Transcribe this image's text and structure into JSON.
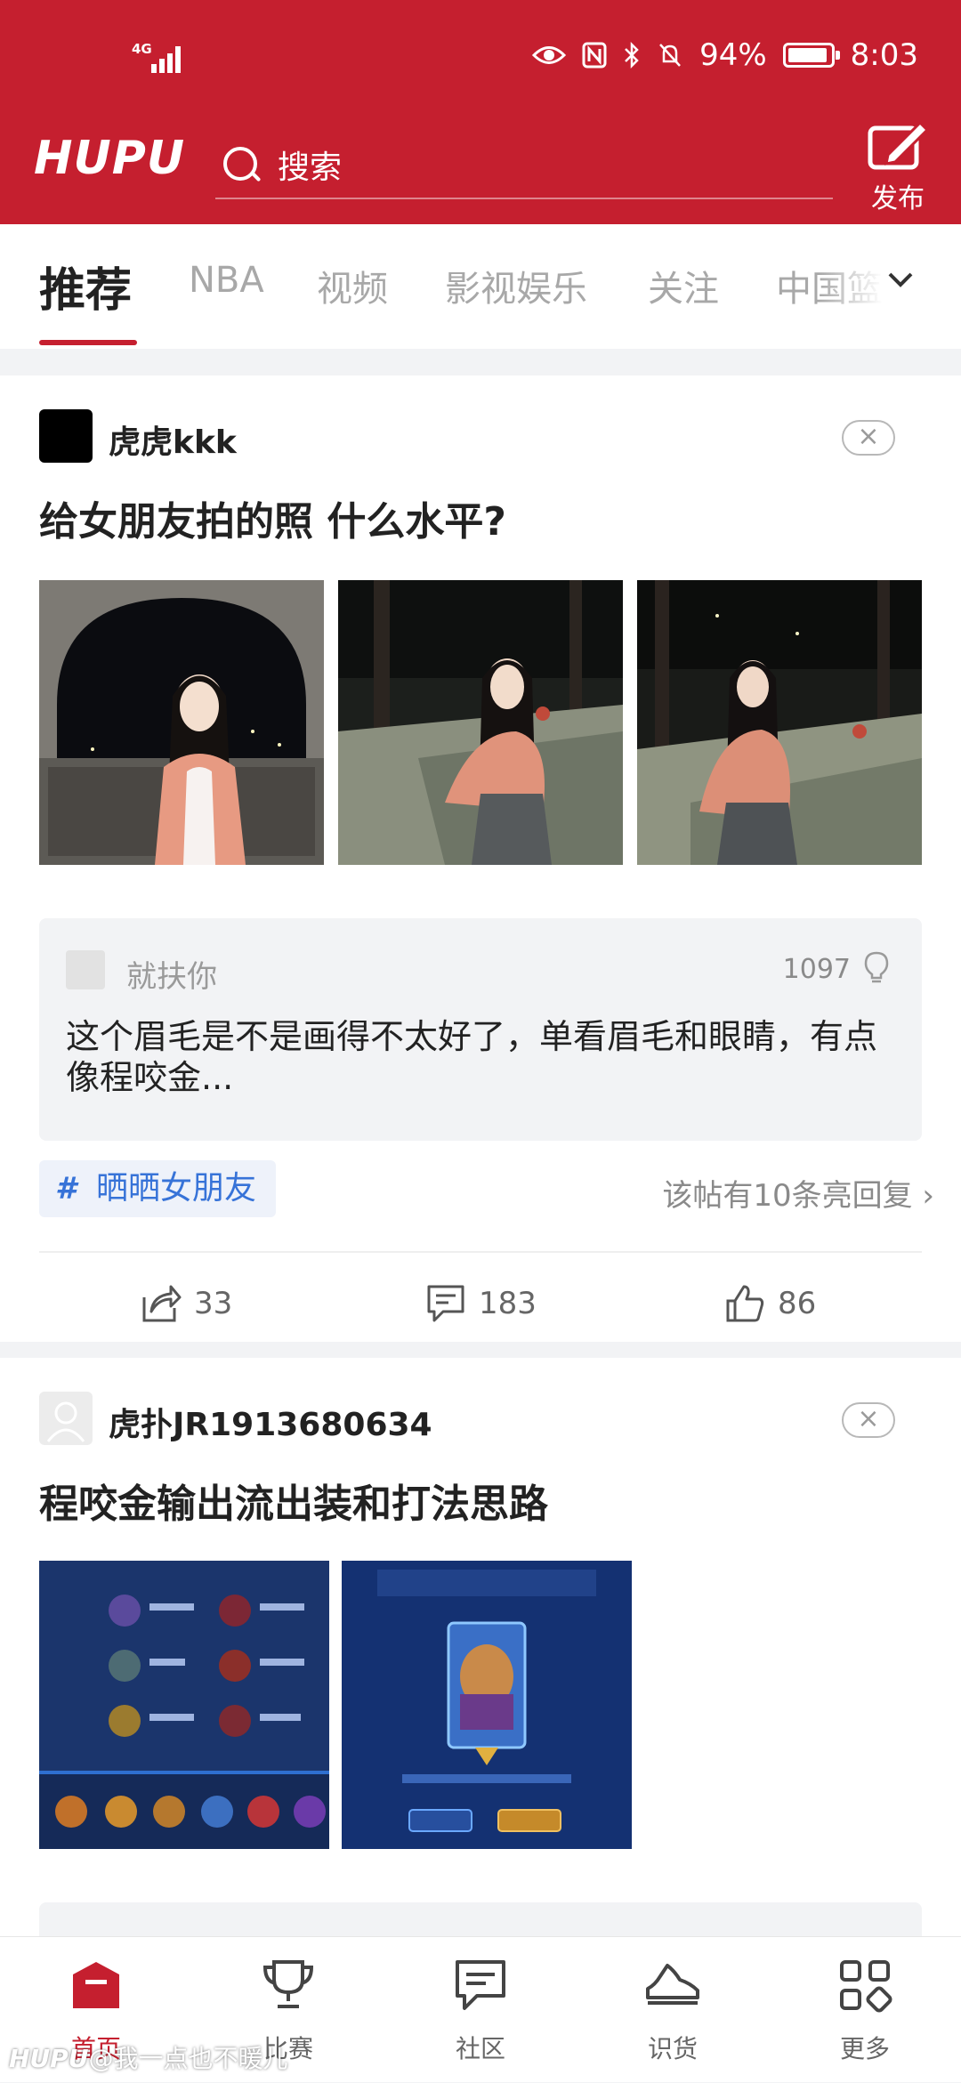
{
  "status_bar": {
    "network": "4G",
    "battery": "94%",
    "battery_level": 0.94,
    "time": "8:03"
  },
  "header": {
    "logo": "HUPU",
    "search_placeholder": "搜索",
    "publish_label": "发布"
  },
  "tabs": {
    "items": [
      {
        "label": "推荐"
      },
      {
        "label": "NBA"
      },
      {
        "label": "视频"
      },
      {
        "label": "影视娱乐"
      },
      {
        "label": "关注"
      },
      {
        "label": "中国篮"
      }
    ],
    "active_index": 0,
    "more_icon": "chevron-down-icon"
  },
  "posts": [
    {
      "username": "虎虎kkk",
      "title": "给女朋友拍的照 什么水平?",
      "top_comment": {
        "user": "就扶你",
        "likes": "1097",
        "text": "这个眉毛是不是画得不太好了，单看眉毛和眼睛，有点像程咬金..."
      },
      "topic": "晒晒女朋友",
      "hot_replies": "该帖有10条亮回复 ›",
      "share_count": "33",
      "comment_count": "183",
      "like_count": "86"
    },
    {
      "username": "虎扑JR1913680634",
      "title": "程咬金输出流出装和打法思路"
    }
  ],
  "bottom_nav": {
    "items": [
      {
        "label": "首页",
        "icon": "home-icon"
      },
      {
        "label": "比赛",
        "icon": "trophy-icon"
      },
      {
        "label": "社区",
        "icon": "chat-icon"
      },
      {
        "label": "识货",
        "icon": "sneaker-icon"
      },
      {
        "label": "更多",
        "icon": "grid-icon"
      }
    ],
    "active_index": 0
  },
  "watermark": {
    "logo": "HUPU",
    "text": "@我一点也不暖儿"
  },
  "colors": {
    "brand_red": "#c51f2f",
    "link_blue": "#3773d8"
  }
}
